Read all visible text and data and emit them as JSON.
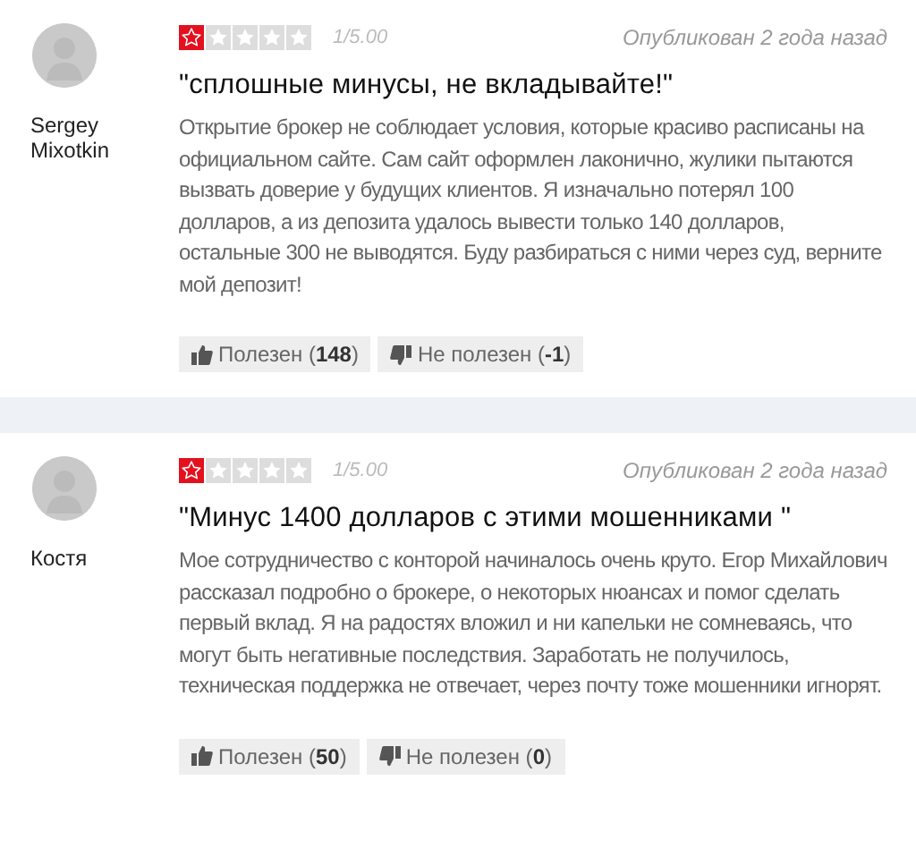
{
  "reviews": [
    {
      "author": "Sergey Mixotkin",
      "stars": 1,
      "score": "1/5.00",
      "published": "Опубликован 2 года назад",
      "title": "\"сплошные минусы, не вкладывайте!\"",
      "text": "Открытие брокер не соблюдает условия, которые красиво расписаны на официальном сайте. Сам сайт оформлен лаконично, жулики пытаются вызвать доверие у будущих клиентов. Я изначально потерял 100 долларов, а из депозита удалось вывести только 140 долларов, остальные 300 не выводятся. Буду разбираться с ними через суд, верните мой депозит!",
      "helpful": "Полезен (**148**)",
      "not_helpful": "Не полезен (**-1**)"
    },
    {
      "author": "Костя",
      "stars": 1,
      "score": "1/5.00",
      "published": "Опубликован 2 года назад",
      "title": "\"Минус 1400 долларов с этими мошенниками \"",
      "text": "Мое сотрудничество с конторой начиналось очень круто. Егор Михайлович рассказал подробно о брокере, о некоторых нюансах и помог сделать первый вклад. Я на радостях вложил и ни капельки не сомневаясь, что могут быть негативные последствия. Заработать не получилось, техническая поддержка не отвечает, через почту тоже мошенники игнорят.",
      "helpful": "Полезен (**50**)",
      "not_helpful": "Не полезен (**0**)"
    }
  ]
}
